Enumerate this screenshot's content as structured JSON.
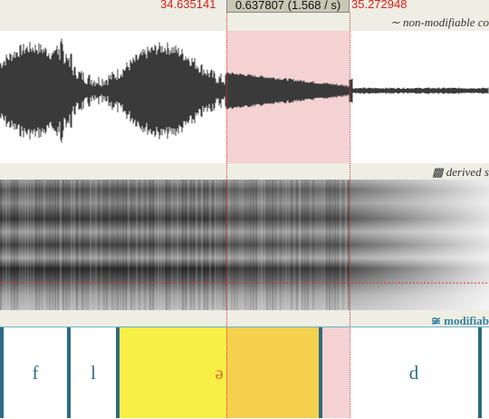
{
  "selection": {
    "start": "34.635141",
    "duration": "0.637807 (1.568 / s)",
    "end": "35.272948"
  },
  "tiers": {
    "waveform": {
      "icon": "∼",
      "label": "non-modifiable co"
    },
    "spectrogram": {
      "icon": "▩",
      "label": "derived s"
    },
    "segments": {
      "icon": "≆",
      "label": "modifiab",
      "items": [
        "f",
        "l",
        "ə",
        "d"
      ]
    }
  },
  "colors": {
    "selection": "#f5d2d2",
    "segment_highlight": "#f7ef45",
    "segment_overlap": "#f5d04f",
    "boundary": "#2e6a83",
    "time_red": "#d8211b"
  }
}
